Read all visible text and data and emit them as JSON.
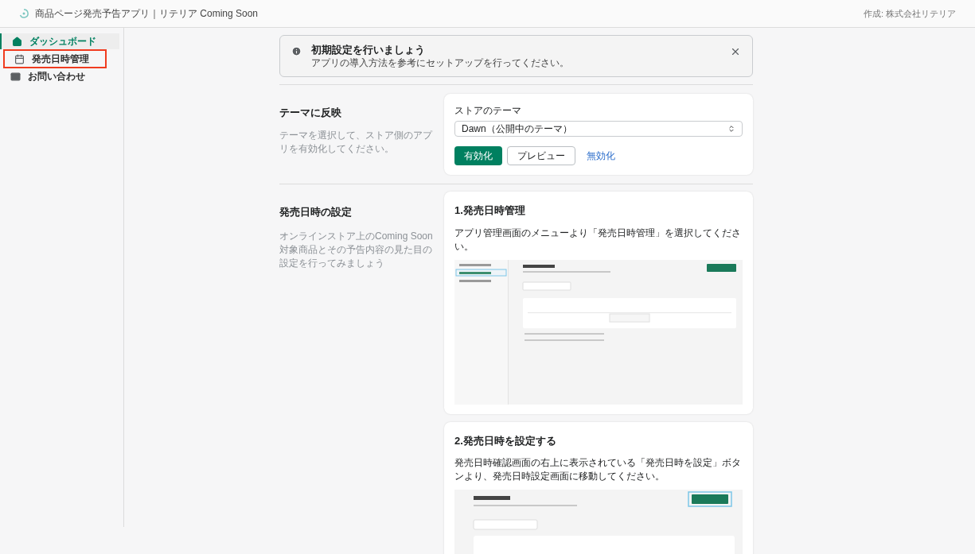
{
  "header": {
    "title": "商品ページ発売予告アプリ｜リテリア Coming Soon",
    "credit": "作成: 株式会社リテリア"
  },
  "sidebar": {
    "items": [
      {
        "label": "ダッシュボード",
        "selected": true,
        "highlighted": false
      },
      {
        "label": "発売日時管理",
        "selected": false,
        "highlighted": true
      },
      {
        "label": "お問い合わせ",
        "selected": false,
        "highlighted": false
      }
    ]
  },
  "banner": {
    "title": "初期設定を行いましょう",
    "message": "アプリの導入方法を参考にセットアップを行ってください。",
    "dismissible": true
  },
  "theme_section": {
    "title": "テーマに反映",
    "description": "テーマを選択して、ストア側のアプリを有効化してください。",
    "select_label": "ストアのテーマ",
    "select_value": "Dawn（公開中のテーマ）",
    "buttons": [
      {
        "label": "有効化",
        "kind": "primary"
      },
      {
        "label": "プレビュー",
        "kind": "secondary"
      },
      {
        "label": "無効化",
        "kind": "plain"
      }
    ]
  },
  "release_section": {
    "title": "発売日時の設定",
    "description": "オンラインストア上のComing Soon対象商品とその予告内容の見た目の設定を行ってみましょう",
    "steps": [
      {
        "title": "1.発売日時管理",
        "text": "アプリ管理画面のメニューより「発売日時管理」を選択してください。"
      },
      {
        "title": "2.発売日時を設定する",
        "text": "発売日時確認画面の右上に表示されている「発売日時を設定」ボタンより、発売日時設定画面に移動してください。"
      }
    ]
  }
}
